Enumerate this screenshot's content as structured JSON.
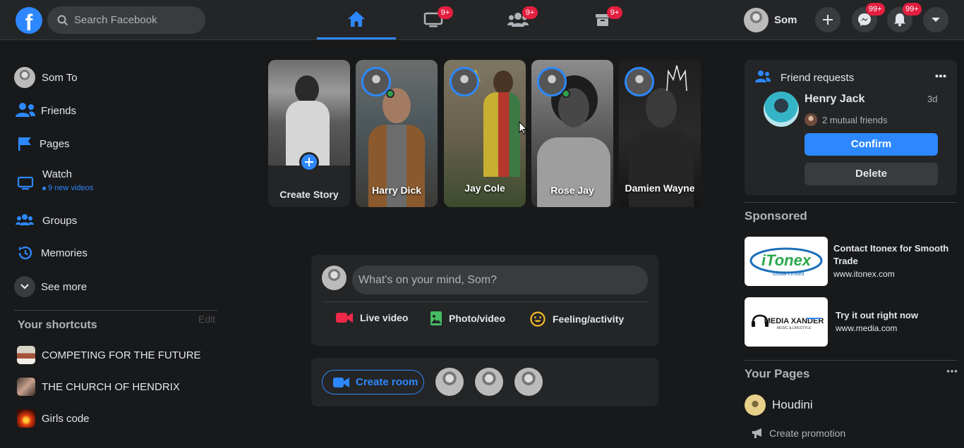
{
  "colors": {
    "accent": "#2d88ff",
    "background": "#18191a",
    "surface": "#242526",
    "badge": "#e41e3f",
    "online": "#31a24c"
  },
  "search": {
    "placeholder": "Search Facebook"
  },
  "nav": {
    "tabs": [
      {
        "name": "home",
        "icon": "home-icon",
        "active": true,
        "badge": ""
      },
      {
        "name": "watch",
        "icon": "watch-icon",
        "badge": "9+"
      },
      {
        "name": "groups",
        "icon": "groups-icon",
        "badge": "9+"
      },
      {
        "name": "marketplace",
        "icon": "marketplace-icon",
        "badge": "9+"
      }
    ],
    "profile_name": "Som",
    "messenger_badge": "99+",
    "notifications_badge": "99+"
  },
  "sidebar": {
    "items": [
      {
        "label": "Som To",
        "icon": "avatar"
      },
      {
        "label": "Friends",
        "icon": "friends-icon"
      },
      {
        "label": "Pages",
        "icon": "flag-icon"
      },
      {
        "label": "Watch",
        "icon": "watch-icon",
        "sub": "9 new videos"
      },
      {
        "label": "Groups",
        "icon": "groups-icon"
      },
      {
        "label": "Memories",
        "icon": "memories-icon"
      },
      {
        "label": "See more",
        "icon": "chevron-down-icon"
      }
    ],
    "shortcuts_title": "Your shortcuts",
    "edit_label": "Edit",
    "shortcuts": [
      "COMPETING FOR THE FUTURE",
      "THE CHURCH OF HENDRIX",
      "Girls code"
    ]
  },
  "stories": {
    "create_label": "Create Story",
    "items": [
      "Harry Dick",
      "Jay Cole",
      "Rose Jay",
      "Damien Wayne"
    ]
  },
  "composer": {
    "placeholder": "What's on your mind, Som?",
    "live_label": "Live video",
    "photo_label": "Photo/video",
    "feeling_label": "Feeling/activity"
  },
  "rooms": {
    "create_label": "Create room"
  },
  "friend_requests": {
    "title": "Friend requests",
    "name": "Henry Jack",
    "time": "3d",
    "mutual": "2 mutual friends",
    "confirm_label": "Confirm",
    "delete_label": "Delete"
  },
  "sponsored": {
    "title": "Sponsored",
    "ads": [
      {
        "title": "Contact Itonex for Smooth Trade",
        "url": "www.itonex.com",
        "logo_text": "iTonex",
        "logo_sub": "Global Limited"
      },
      {
        "title": "Try it out right now",
        "url": "www.media.com",
        "logo_text": "MEDIA XANDER",
        "logo_sub": "MUSIC & LIFESTYLE"
      }
    ]
  },
  "your_pages": {
    "title": "Your Pages",
    "page_name": "Houdini",
    "promo_label": "Create promotion"
  }
}
